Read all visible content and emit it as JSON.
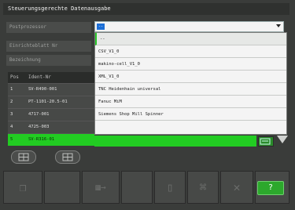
{
  "window": {
    "title": "Steuerungsgerechte Datenausgabe"
  },
  "fields": {
    "postprozessor_label": "Postprozessor",
    "einrichteblatt_label": "Einrichteblatt Nr",
    "bezeichnung_label": "Bezeichnung"
  },
  "dropdown": {
    "items": [
      "--",
      "CSV_V1_0",
      "makino-cell_V1_0",
      "XML_V1_0",
      "TNC Heidenhain universal",
      "Fanuc MiM",
      "Siemens Shop Mill Spinner"
    ]
  },
  "table": {
    "headers": [
      "Pos",
      "Ident-Nr"
    ],
    "rows": [
      {
        "pos": "1",
        "ident": "SV-R490-001"
      },
      {
        "pos": "2",
        "ident": "PT-1101-20.5-01"
      },
      {
        "pos": "3",
        "ident": "4717-001"
      },
      {
        "pos": "4",
        "ident": "4725-003"
      },
      {
        "pos": "5",
        "ident": "SV-R316-01"
      }
    ]
  },
  "toolbar": {
    "help_label": "?"
  },
  "icons": {
    "copy": "copy-icon",
    "export": "export-icon",
    "trash": "trash-icon",
    "cancel": "cancel-icon",
    "help": "help-icon"
  },
  "colors": {
    "accent": "#22cc22",
    "background": "#3a3c3a"
  }
}
